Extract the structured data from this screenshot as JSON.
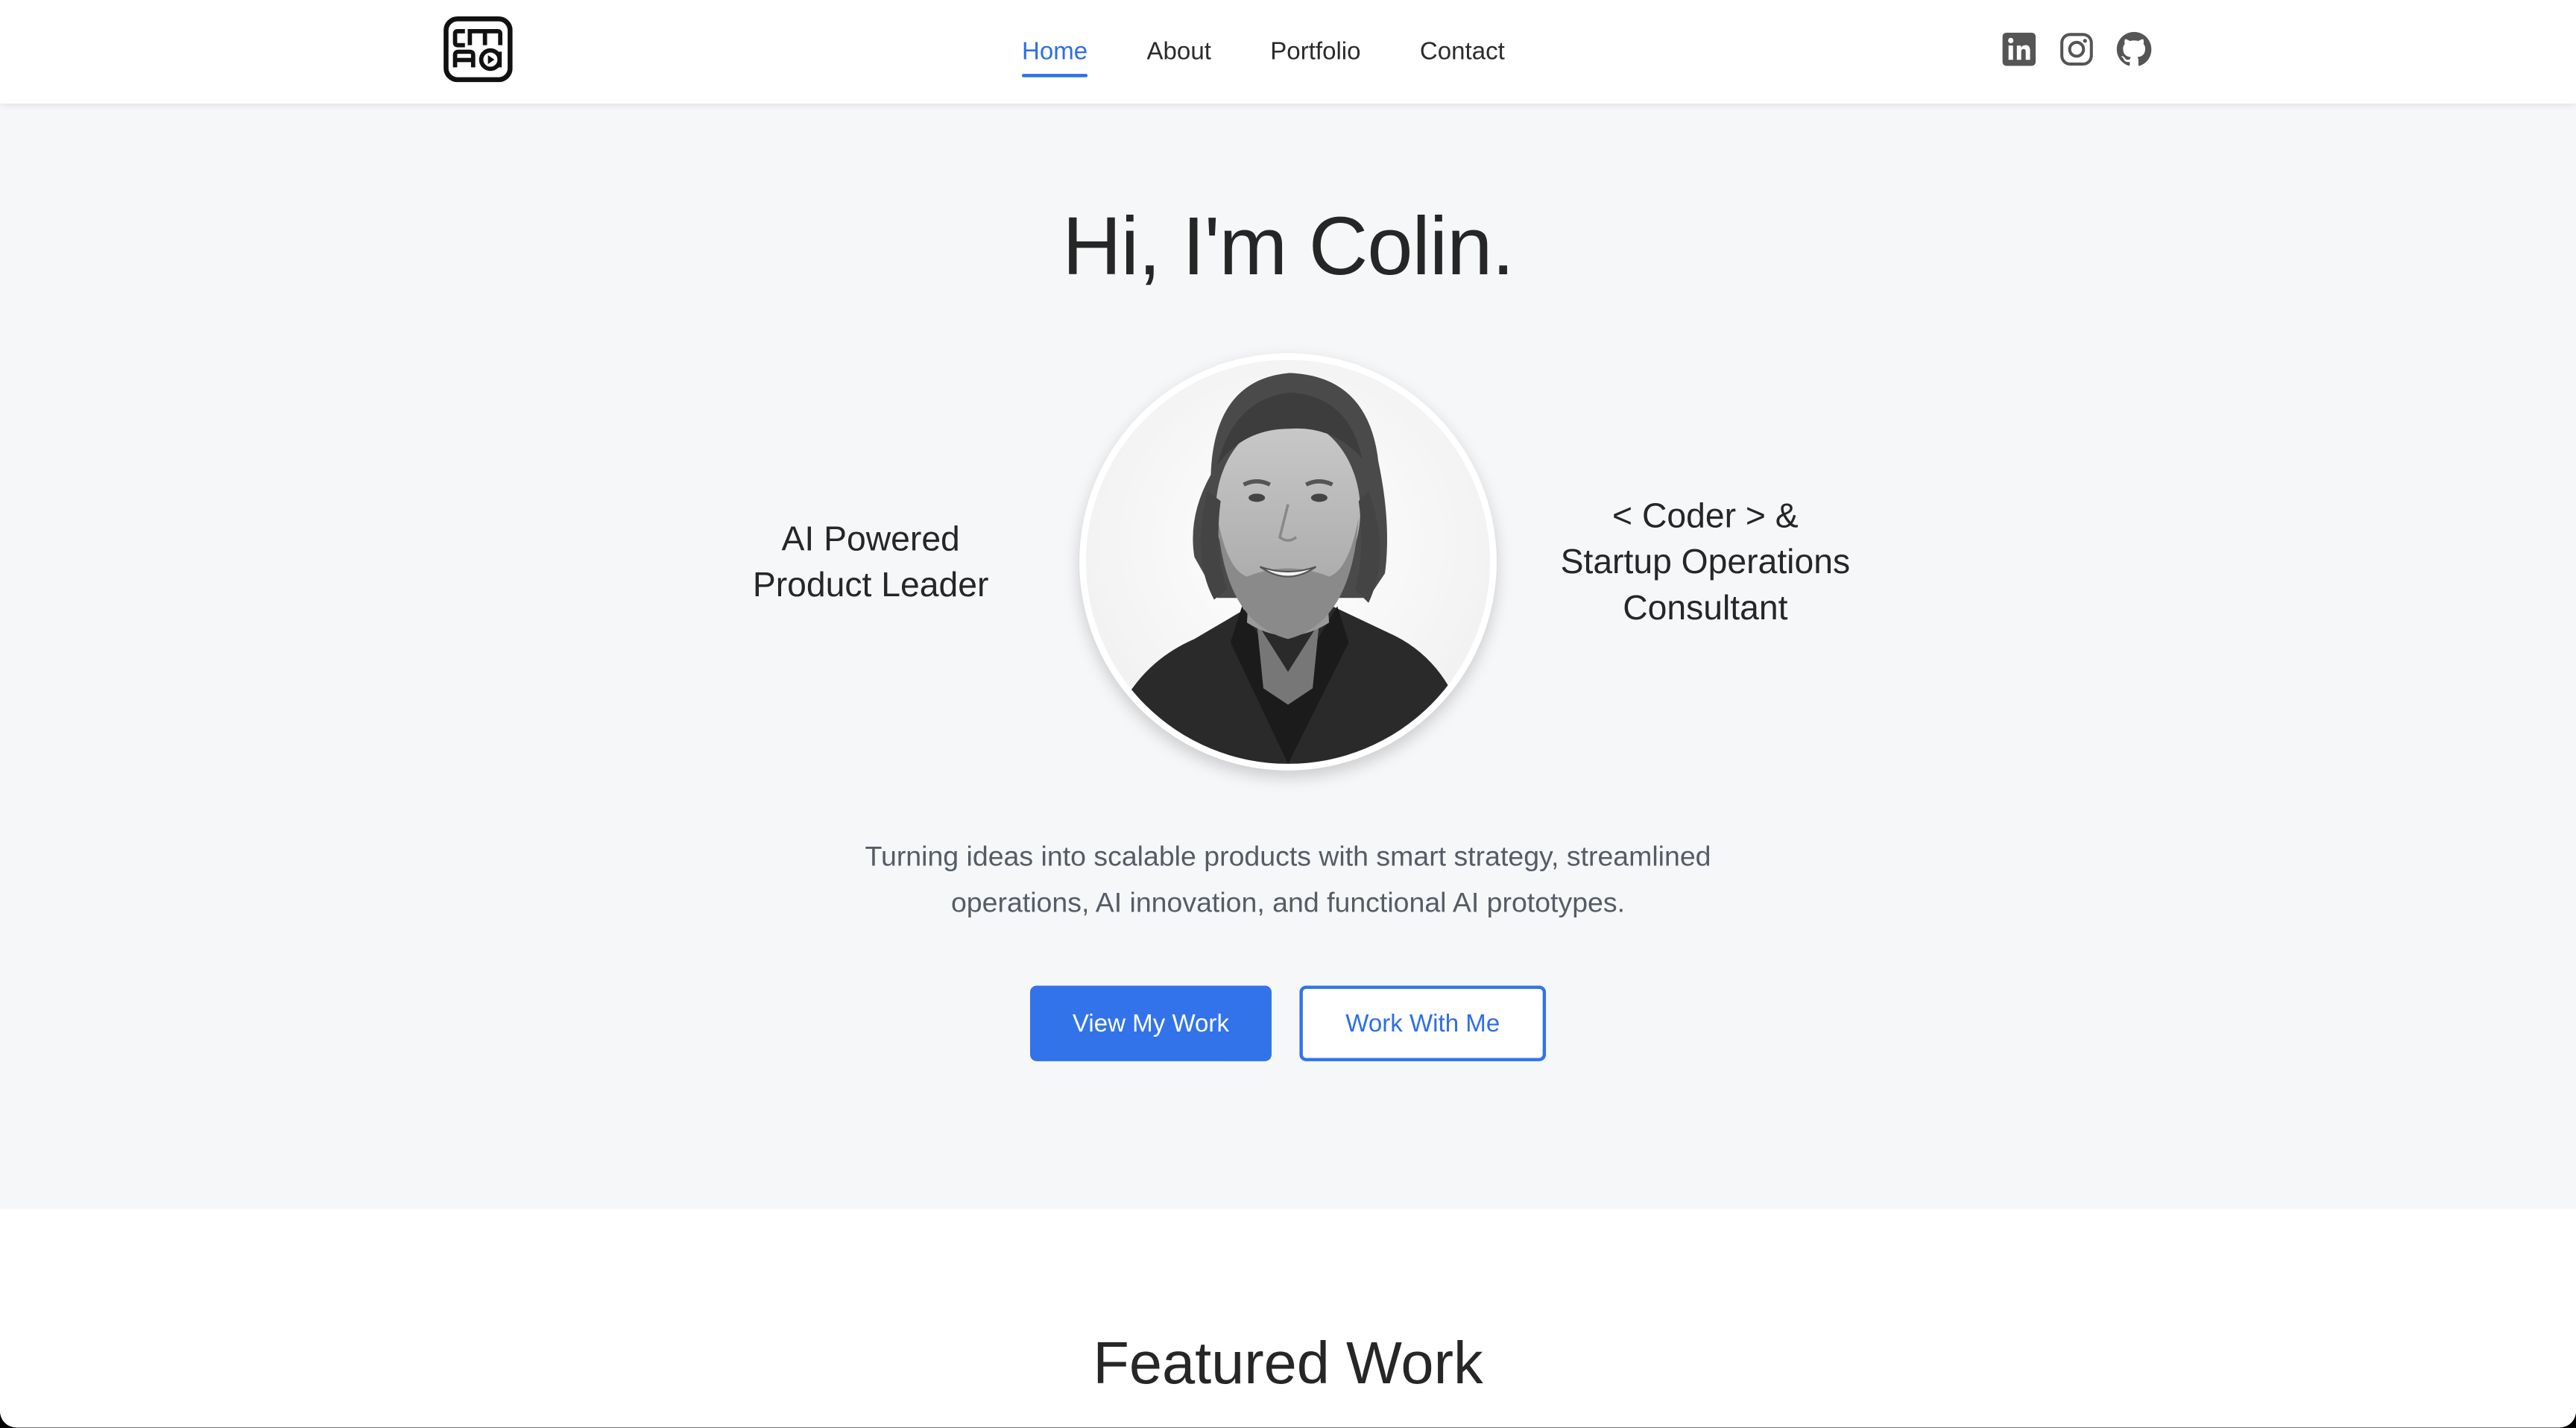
{
  "header": {
    "logo_text": "CM AO",
    "nav": [
      {
        "label": "Home",
        "active": true
      },
      {
        "label": "About",
        "active": false
      },
      {
        "label": "Portfolio",
        "active": false
      },
      {
        "label": "Contact",
        "active": false
      }
    ],
    "socials": [
      "linkedin-icon",
      "instagram-icon",
      "github-icon"
    ]
  },
  "hero": {
    "title": "Hi, I'm Colin.",
    "left_text": "AI Powered\nProduct Leader",
    "right_text": "< Coder > &\nStartup Operations\nConsultant",
    "tagline": "Turning ideas into scalable products with smart strategy, streamlined operations, AI innovation, and functional AI prototypes.",
    "primary_button": "View My Work",
    "secondary_button": "Work With Me"
  },
  "featured": {
    "title": "Featured Work"
  },
  "colors": {
    "accent": "#3273ea",
    "hero_bg": "#f6f7f9",
    "text": "#262626",
    "muted_text": "#555c66"
  }
}
